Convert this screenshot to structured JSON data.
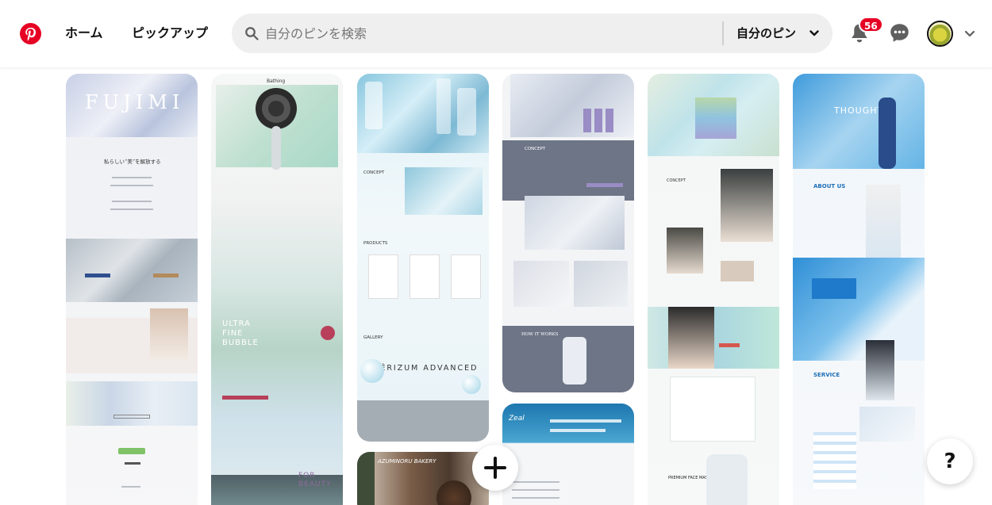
{
  "header": {
    "nav": {
      "home": "ホーム",
      "pickup": "ピックアップ"
    },
    "search": {
      "placeholder": "自分のピンを検索",
      "scope": "自分のピン"
    },
    "notifications_count": "56",
    "brand_color": "#e60023"
  },
  "pins": [
    {
      "wordmark": "FUJIMI",
      "line": "私らしい“美”を解放する"
    },
    {
      "brand": "Bathing",
      "headline": "ULTRA FINE BUBBLE",
      "sub": "FOR BEAUTY"
    },
    {
      "wordmark": "DÉRIZUM ADVANCED",
      "sections": [
        "CONCEPT",
        "PRODUCTS",
        "GALLERY"
      ]
    },
    {
      "sections": [
        "CONCEPT",
        "HOW IT WORKS"
      ]
    },
    {
      "sections": [
        "CONCEPT",
        "PREMIUM FACE MASK"
      ]
    },
    {
      "headline": "THOUGHT",
      "sections": [
        "ABOUT US",
        "SERVICE"
      ]
    },
    {
      "brand": "AZUMINORU BAKERY"
    },
    {
      "brand": "Zeal"
    }
  ],
  "fab": {
    "help": "?"
  }
}
